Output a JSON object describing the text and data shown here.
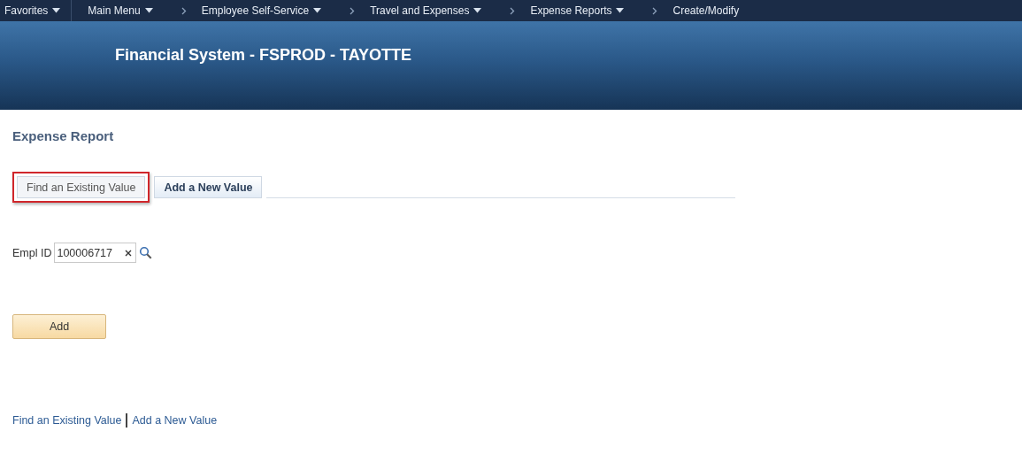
{
  "nav": [
    {
      "label": "Favorites",
      "separator": false,
      "menu": true
    },
    {
      "label": "Main Menu",
      "separator": false,
      "menu": true
    },
    {
      "label": "Employee Self-Service",
      "separator": true,
      "menu": true
    },
    {
      "label": "Travel and Expenses",
      "separator": true,
      "menu": true
    },
    {
      "label": "Expense Reports",
      "separator": true,
      "menu": true
    },
    {
      "label": "Create/Modify",
      "separator": true,
      "menu": false
    }
  ],
  "banner": {
    "title": "Financial System - FSPROD - TAYOTTE"
  },
  "page_title": "Expense Report",
  "tabs": [
    {
      "label": "Find an Existing Value",
      "selected": false,
      "highlighted": true
    },
    {
      "label": "Add a New Value",
      "selected": true,
      "highlighted": false
    }
  ],
  "field": {
    "label": "Empl ID",
    "value": "100006717"
  },
  "button": "Add",
  "footer_links": [
    "Find an Existing Value",
    "Add a New Value"
  ]
}
